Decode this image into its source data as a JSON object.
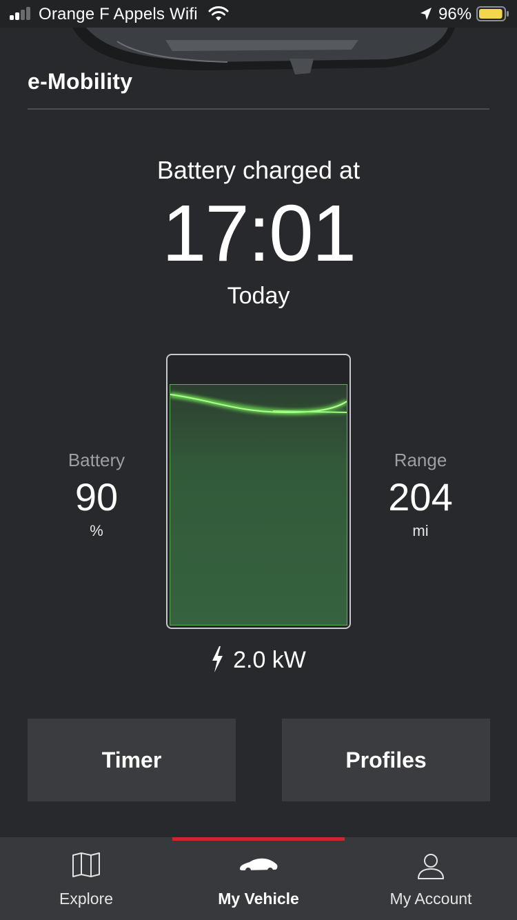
{
  "status_bar": {
    "carrier": "Orange F Appels Wifi",
    "battery_percent": "96%",
    "signal_bars_active": 2,
    "signal_bars_total": 4,
    "battery_fill": 0.96,
    "battery_color": "#f2d64b"
  },
  "header": {
    "title": "e-Mobility"
  },
  "charge_status": {
    "label": "Battery charged at",
    "time": "17:01",
    "day": "Today"
  },
  "battery": {
    "label": "Battery",
    "value": "90",
    "unit": "%",
    "level": 0.9,
    "fill_color": "#36623f",
    "glow_color": "#7dff5a"
  },
  "range": {
    "label": "Range",
    "value": "204",
    "unit": "mi"
  },
  "power": {
    "icon": "lightning-icon",
    "value": "2.0 kW"
  },
  "actions": {
    "timer_label": "Timer",
    "profiles_label": "Profiles"
  },
  "tabbar": {
    "active_color": "#d5232a",
    "tabs": [
      {
        "label": "Explore",
        "icon": "map-icon",
        "active": false
      },
      {
        "label": "My Vehicle",
        "icon": "car-icon",
        "active": true
      },
      {
        "label": "My Account",
        "icon": "person-icon",
        "active": false
      }
    ]
  }
}
